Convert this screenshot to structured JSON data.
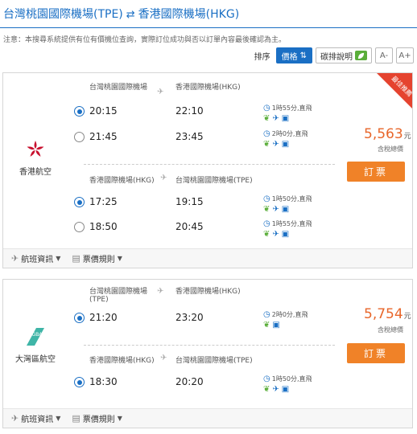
{
  "header": {
    "origin": "台灣桃園國際機場(TPE)",
    "arrow": "⇄",
    "destination": "香港國際機場(HKG)"
  },
  "notice": "注意：本搜尋系統提供有位有價機位查詢，實際訂位成功與否以訂單內容最後確認為主。",
  "toolbar": {
    "sort_label": "排序",
    "price_label": "價格",
    "price_icon": "⇅",
    "eco_label": "碳排說明",
    "font_smaller": "A-",
    "font_larger": "A+"
  },
  "cards": [
    {
      "ribbon": "最佳推薦",
      "airline_name": "香港航空",
      "price": "5,563",
      "currency": "元",
      "tax_note": "含稅總價",
      "book_label": "訂票",
      "outbound": {
        "from": "台灣桃園國際機場",
        "to": "香港國際機場(HKG)",
        "options": [
          {
            "dep": "20:15",
            "arr": "22:10",
            "duration": "1時55分,直飛",
            "selected": true
          },
          {
            "dep": "21:45",
            "arr": "23:45",
            "duration": "2時0分,直飛",
            "selected": false
          }
        ]
      },
      "inbound": {
        "from": "香港國際機場(HKG)",
        "to": "台灣桃園國際機場(TPE)",
        "options": [
          {
            "dep": "17:25",
            "arr": "19:15",
            "duration": "1時50分,直飛",
            "selected": true
          },
          {
            "dep": "18:50",
            "arr": "20:45",
            "duration": "1時55分,直飛",
            "selected": false
          }
        ]
      },
      "footer": {
        "flight_info": "航班資訊",
        "fare_rules": "票價規則"
      }
    },
    {
      "airline_name": "大灣區航空",
      "price": "5,754",
      "currency": "元",
      "tax_note": "含稅總價",
      "book_label": "訂票",
      "outbound": {
        "from": "台灣桃園國際機場",
        "from_code": "(TPE)",
        "to": "香港國際機場(HKG)",
        "options": [
          {
            "dep": "21:20",
            "arr": "23:20",
            "duration": "2時0分,直飛",
            "selected": true
          }
        ]
      },
      "inbound": {
        "from": "香港國際機場(HKG)",
        "to": "台灣桃園國際機場(TPE)",
        "options": [
          {
            "dep": "18:30",
            "arr": "20:20",
            "duration": "1時50分,直飛",
            "selected": true
          }
        ]
      },
      "footer": {
        "flight_info": "航班資訊",
        "fare_rules": "票價規則"
      }
    }
  ],
  "colors": {
    "brand": "#1a6fc4",
    "price": "#e8662a",
    "book": "#f08228",
    "ribbon": "#e5432f",
    "eco": "#5aae3a"
  }
}
